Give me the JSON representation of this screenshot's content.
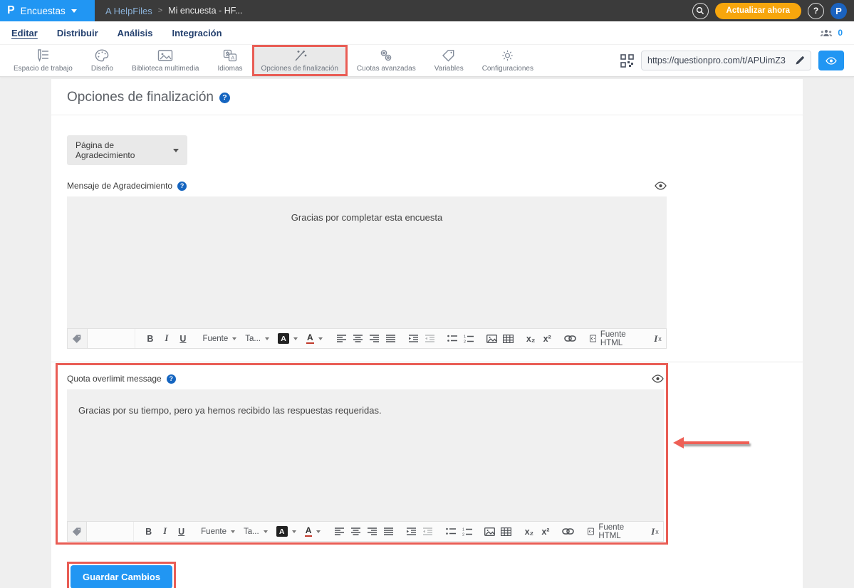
{
  "colors": {
    "topbar_blue": "#2196f3",
    "topbar_dark": "#3b3b3b",
    "accent_orange": "#f7a60d",
    "annotation_red": "#e95d55",
    "primary_blue": "#2196f3",
    "tab_navy": "#24406e",
    "editor_bg": "#f0f0f0"
  },
  "topbar": {
    "logo": "P",
    "product": "Encuestas",
    "breadcrumb_folder": "A HelpFiles",
    "breadcrumb_sep": ">",
    "breadcrumb_page": "Mi encuesta - HF...",
    "update_button": "Actualizar ahora",
    "help": "?",
    "avatar": "P"
  },
  "tabs": {
    "items": [
      {
        "label": "Editar",
        "active": true
      },
      {
        "label": "Distribuir",
        "active": false
      },
      {
        "label": "Análisis",
        "active": false
      },
      {
        "label": "Integración",
        "active": false
      }
    ],
    "collaborators_count": "0"
  },
  "ribbon": {
    "items": [
      {
        "label": "Espacio de trabajo",
        "icon": "workspace-icon"
      },
      {
        "label": "Diseño",
        "icon": "palette-icon"
      },
      {
        "label": "Biblioteca multimedia",
        "icon": "image-icon"
      },
      {
        "label": "Idiomas",
        "icon": "translate-icon"
      },
      {
        "label": "Opciones de finalización",
        "icon": "wand-icon",
        "highlighted": true
      },
      {
        "label": "Cuotas avanzadas",
        "icon": "links-icon"
      },
      {
        "label": "Variables",
        "icon": "tag-icon"
      },
      {
        "label": "Configuraciones",
        "icon": "gear-icon"
      }
    ],
    "share_url": "https://questionpro.com/t/APUimZ3"
  },
  "main": {
    "title": "Opciones de finalización",
    "title_help": "?",
    "page_select": "Página de Agradecimiento",
    "thankyou_label": "Mensaje de Agradecimiento",
    "thankyou_help": "?",
    "thankyou_text": "Gracias por completar esta encuesta",
    "quota_label": "Quota overlimit message",
    "quota_help": "?",
    "quota_text": "Gracias por su tiempo, pero ya hemos recibido las respuestas requeridas.",
    "save_button": "Guardar Cambios"
  },
  "editor": {
    "bold": "B",
    "italic": "I",
    "underline": "U",
    "font": "Fuente",
    "size": "Ta...",
    "bg_letter": "A",
    "color_letter": "A",
    "sub": "x₂",
    "sup": "x²",
    "html": "Fuente HTML",
    "clear_i": "I",
    "clear_x": "x"
  }
}
